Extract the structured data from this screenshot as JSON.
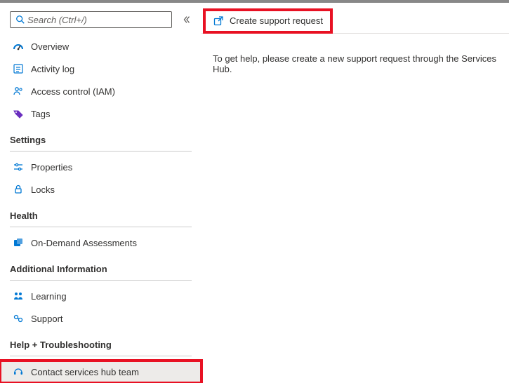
{
  "sidebar": {
    "search_placeholder": "Search (Ctrl+/)",
    "top_items": [
      {
        "label": "Overview"
      },
      {
        "label": "Activity log"
      },
      {
        "label": "Access control (IAM)"
      },
      {
        "label": "Tags"
      }
    ],
    "sections": [
      {
        "title": "Settings",
        "items": [
          {
            "label": "Properties"
          },
          {
            "label": "Locks"
          }
        ]
      },
      {
        "title": "Health",
        "items": [
          {
            "label": "On-Demand Assessments"
          }
        ]
      },
      {
        "title": "Additional Information",
        "items": [
          {
            "label": "Learning"
          },
          {
            "label": "Support"
          }
        ]
      },
      {
        "title": "Help + Troubleshooting",
        "items": [
          {
            "label": "Contact services hub team"
          }
        ]
      }
    ]
  },
  "toolbar": {
    "create_request_label": "Create support request"
  },
  "main": {
    "description": "To get help, please create a new support request through the Services Hub."
  }
}
